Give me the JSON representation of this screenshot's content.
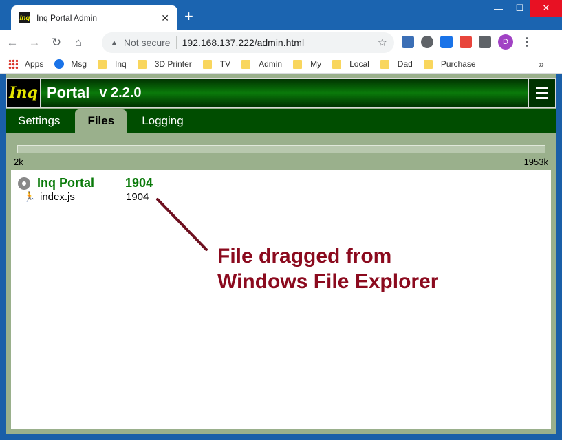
{
  "browser": {
    "tab_title": "Inq Portal Admin",
    "tab_favicon_text": "Inq",
    "new_tab": "+",
    "window_controls": {
      "minimize": "—",
      "maximize": "☐",
      "close": "✕"
    },
    "nav": {
      "back": "←",
      "forward": "→",
      "reload": "↻",
      "home": "⌂"
    },
    "omnibox": {
      "security_label": "Not secure",
      "url": "192.168.137.222/admin.html",
      "warn_icon": "▲",
      "star": "☆"
    },
    "extension_icons": [
      "#3b6fb6",
      "#5f6368",
      "#1a73e8",
      "#e8453c",
      "#5f6368"
    ],
    "profile_initial": "D",
    "menu": "⋮",
    "bookmarks": {
      "apps": "Apps",
      "msg": "Msg",
      "folders": [
        "Inq",
        "3D Printer",
        "TV",
        "Admin",
        "My",
        "Local",
        "Dad",
        "Purchase"
      ],
      "more": "»"
    }
  },
  "app": {
    "logo": "Inq",
    "name": "Portal",
    "version": "v 2.2.0",
    "tabs": [
      {
        "label": "Settings",
        "active": false
      },
      {
        "label": "Files",
        "active": true
      },
      {
        "label": "Logging",
        "active": false
      }
    ],
    "storage": {
      "min_label": "2k",
      "max_label": "1953k",
      "used_fraction": 0.001
    },
    "folder": {
      "name": "Inq Portal",
      "size": "1904"
    },
    "files": [
      {
        "name": "index.js",
        "size": "1904"
      }
    ],
    "annotation_lines": [
      "File dragged from",
      "Windows File Explorer"
    ],
    "colors": {
      "accent_green": "#0a7a0a",
      "annotation": "#8b0a1e",
      "header_bg": "#004d00"
    }
  }
}
